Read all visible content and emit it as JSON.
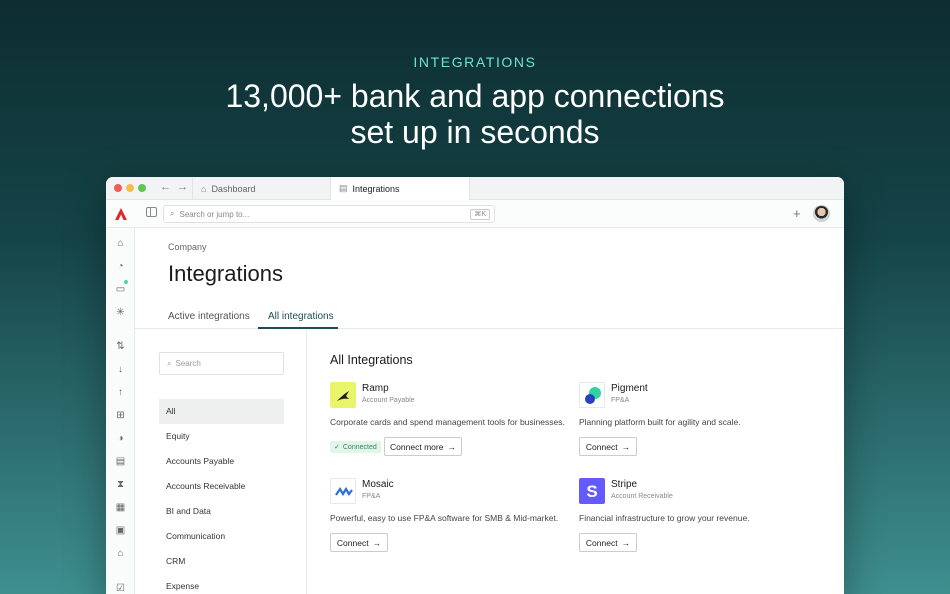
{
  "hero": {
    "eyebrow": "INTEGRATIONS",
    "headline_line1": "13,000+ bank and app connections",
    "headline_line2": "set up in seconds"
  },
  "browser": {
    "tabs": [
      {
        "label": "Dashboard",
        "icon": "home-icon"
      },
      {
        "label": "Integrations",
        "icon": "building-icon"
      }
    ]
  },
  "toolbar": {
    "search_placeholder": "Search or jump to...",
    "shortcut": "⌘K"
  },
  "page": {
    "breadcrumb": "Company",
    "title": "Integrations",
    "tabs": [
      "Active integrations",
      "All integrations"
    ],
    "active_tab": "All integrations"
  },
  "filters": {
    "search_placeholder": "Search",
    "categories": [
      "All",
      "Equity",
      "Accounts Payable",
      "Accounts Receivable",
      "BI and Data",
      "Communication",
      "CRM",
      "Expense"
    ],
    "selected": "All"
  },
  "integrations": {
    "section_title": "All Integrations",
    "cards": [
      {
        "name": "Ramp",
        "category": "Account Payable",
        "description": "Corporate cards and spend management tools for businesses.",
        "status": "Connected",
        "button": "Connect more",
        "logo_color": "#e8f56b"
      },
      {
        "name": "Pigment",
        "category": "FP&A",
        "description": "Planning platform built for agility and scale.",
        "button": "Connect",
        "logo_color": "#2fd3a0"
      },
      {
        "name": "Mosaic",
        "category": "FP&A",
        "description": "Powerful, easy to use FP&A software for SMB & Mid-market.",
        "button": "Connect",
        "logo_color": "#2a6fdb"
      },
      {
        "name": "Stripe",
        "category": "Account Receivable",
        "description": "Financial infrastructure to grow your revenue.",
        "button": "Connect",
        "logo_color": "#635bff"
      }
    ]
  },
  "colors": {
    "accent": "#1f4d50",
    "eyebrow": "#6fe3d4",
    "connected": "#2f8a56"
  }
}
